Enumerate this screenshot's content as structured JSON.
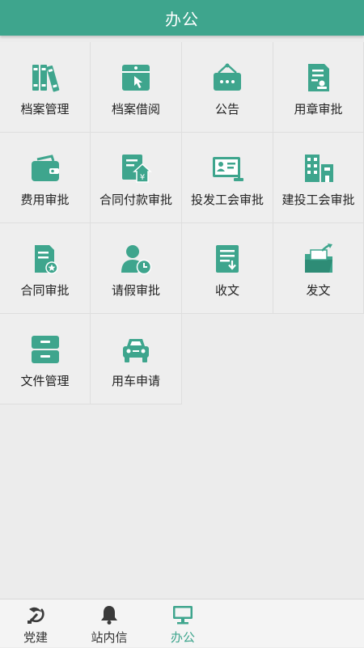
{
  "header": {
    "title": "办公"
  },
  "colors": {
    "accent": "#3ea58d",
    "icon_dark": "#2e8c76",
    "text": "#222222"
  },
  "grid": {
    "items": [
      {
        "label": "档案管理",
        "icon": "binders-icon"
      },
      {
        "label": "档案借阅",
        "icon": "document-touch-icon"
      },
      {
        "label": "公告",
        "icon": "notice-board-icon"
      },
      {
        "label": "用章审批",
        "icon": "seal-document-icon"
      },
      {
        "label": "费用审批",
        "icon": "wallet-icon"
      },
      {
        "label": "合同付款审批",
        "icon": "yen-payment-icon"
      },
      {
        "label": "投发工会审批",
        "icon": "id-card-icon"
      },
      {
        "label": "建投工会审批",
        "icon": "buildings-icon"
      },
      {
        "label": "合同审批",
        "icon": "contract-star-icon"
      },
      {
        "label": "请假审批",
        "icon": "user-clock-icon"
      },
      {
        "label": "收文",
        "icon": "receive-document-icon"
      },
      {
        "label": "发文",
        "icon": "folder-send-icon"
      },
      {
        "label": "文件管理",
        "icon": "file-cabinet-icon"
      },
      {
        "label": "用车申请",
        "icon": "car-icon"
      }
    ]
  },
  "tabbar": {
    "tabs": [
      {
        "label": "党建",
        "icon": "hammer-sickle-icon",
        "active": false
      },
      {
        "label": "站内信",
        "icon": "bell-icon",
        "active": false
      },
      {
        "label": "办公",
        "icon": "monitor-icon",
        "active": true
      }
    ]
  }
}
